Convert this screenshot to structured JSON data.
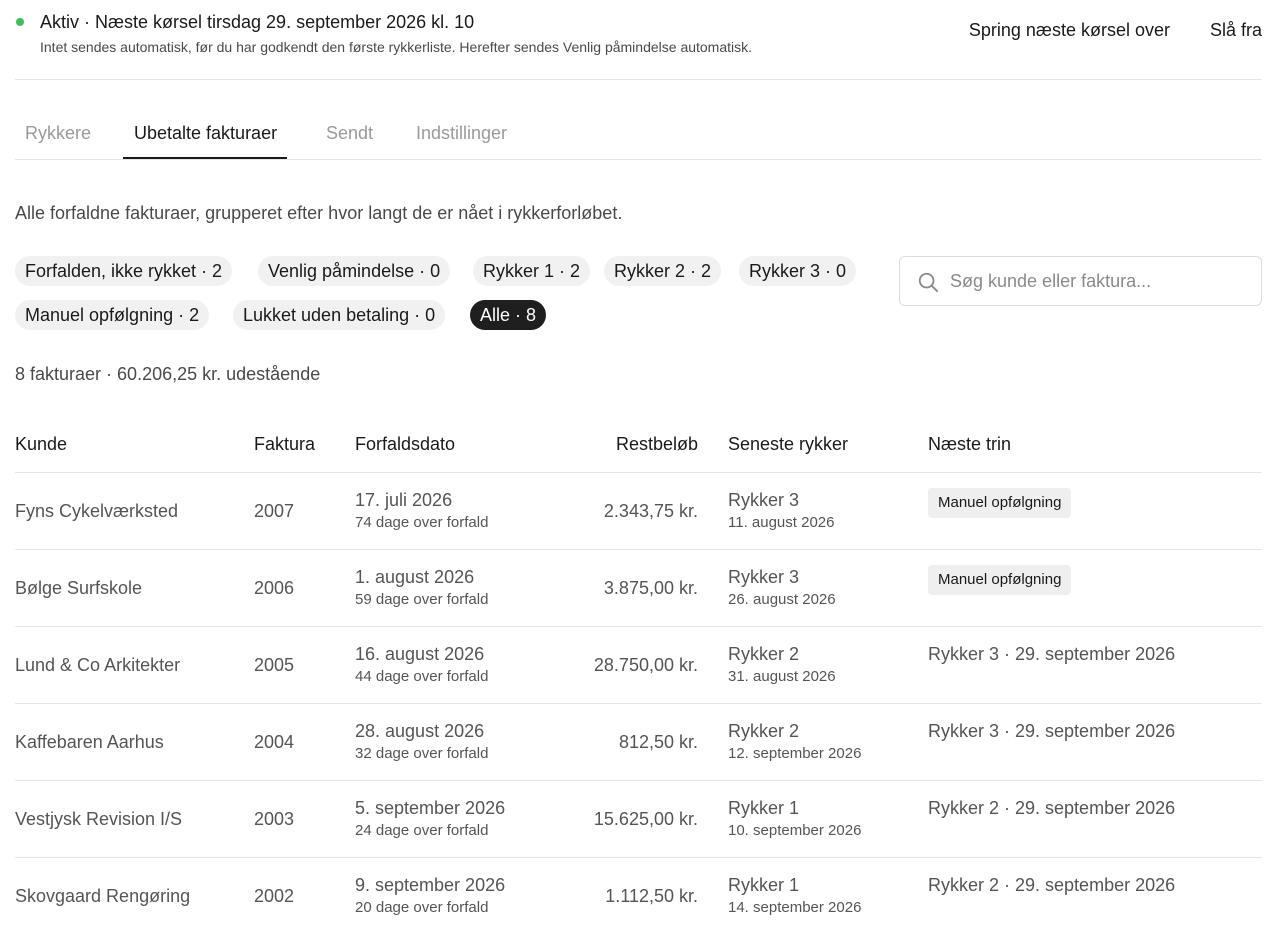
{
  "status": {
    "dot_color": "#3cc05a",
    "title": "Aktiv · Næste kørsel tirsdag 29. september 2026 kl. 10",
    "subtitle": "Intet sendes automatisk, før du har godkendt den første rykkerliste. Herefter sendes Venlig påmindelse automatisk.",
    "skip_label": "Spring næste kørsel over",
    "disable_label": "Slå fra"
  },
  "tabs": [
    {
      "label": "Rykkere",
      "active": false
    },
    {
      "label": "Ubetalte fakturaer",
      "active": true
    },
    {
      "label": "Sendt",
      "active": false
    },
    {
      "label": "Indstillinger",
      "active": false
    }
  ],
  "intro": "Alle forfaldne fakturaer, grupperet efter hvor langt de er nået i rykkerforløbet.",
  "filters": [
    {
      "label": "Forfalden, ikke rykket · 2",
      "active": false
    },
    {
      "label": "Venlig påmindelse · 0",
      "active": false
    },
    {
      "label": "Rykker 1 · 2",
      "active": false
    },
    {
      "label": "Rykker 2 · 2",
      "active": false
    },
    {
      "label": "Rykker 3 · 0",
      "active": false
    },
    {
      "label": "Manuel opfølgning · 2",
      "active": false
    },
    {
      "label": "Lukket uden betaling · 0",
      "active": false
    },
    {
      "label": "Alle · 8",
      "active": true
    }
  ],
  "search": {
    "placeholder": "Søg kunde eller faktura...",
    "value": "",
    "icon": "search-icon"
  },
  "summary": "8 fakturaer · 60.206,25 kr. udestående",
  "table": {
    "headers": {
      "kunde": "Kunde",
      "faktura": "Faktura",
      "forfaldsdato": "Forfaldsdato",
      "restbelob": "Restbeløb",
      "seneste": "Seneste rykker",
      "naeste": "Næste trin"
    },
    "rows": [
      {
        "kunde": "Fyns Cykelværksted",
        "faktura": "2007",
        "forfald": "17. juli 2026",
        "overdue": "74 dage over forfald",
        "rest": "2.343,75 kr.",
        "seneste": "Rykker 3",
        "seneste_dato": "11. august 2026",
        "naeste": "Manuel opfølgning",
        "naeste_badge": true
      },
      {
        "kunde": "Bølge Surfskole",
        "faktura": "2006",
        "forfald": "1. august 2026",
        "overdue": "59 dage over forfald",
        "rest": "3.875,00 kr.",
        "seneste": "Rykker 3",
        "seneste_dato": "26. august 2026",
        "naeste": "Manuel opfølgning",
        "naeste_badge": true
      },
      {
        "kunde": "Lund & Co Arkitekter",
        "faktura": "2005",
        "forfald": "16. august 2026",
        "overdue": "44 dage over forfald",
        "rest": "28.750,00 kr.",
        "seneste": "Rykker 2",
        "seneste_dato": "31. august 2026",
        "naeste": "Rykker 3 · 29. september 2026",
        "naeste_badge": false
      },
      {
        "kunde": "Kaffebaren Aarhus",
        "faktura": "2004",
        "forfald": "28. august 2026",
        "overdue": "32 dage over forfald",
        "rest": "812,50 kr.",
        "seneste": "Rykker 2",
        "seneste_dato": "12. september 2026",
        "naeste": "Rykker 3 · 29. september 2026",
        "naeste_badge": false
      },
      {
        "kunde": "Vestjysk Revision I/S",
        "faktura": "2003",
        "forfald": "5. september 2026",
        "overdue": "24 dage over forfald",
        "rest": "15.625,00 kr.",
        "seneste": "Rykker 1",
        "seneste_dato": "10. september 2026",
        "naeste": "Rykker 2 · 29. september 2026",
        "naeste_badge": false
      },
      {
        "kunde": "Skovgaard Rengøring",
        "faktura": "2002",
        "forfald": "9. september 2026",
        "overdue": "20 dage over forfald",
        "rest": "1.112,50 kr.",
        "seneste": "Rykker 1",
        "seneste_dato": "14. september 2026",
        "naeste": "Rykker 2 · 29. september 2026",
        "naeste_badge": false
      }
    ]
  }
}
